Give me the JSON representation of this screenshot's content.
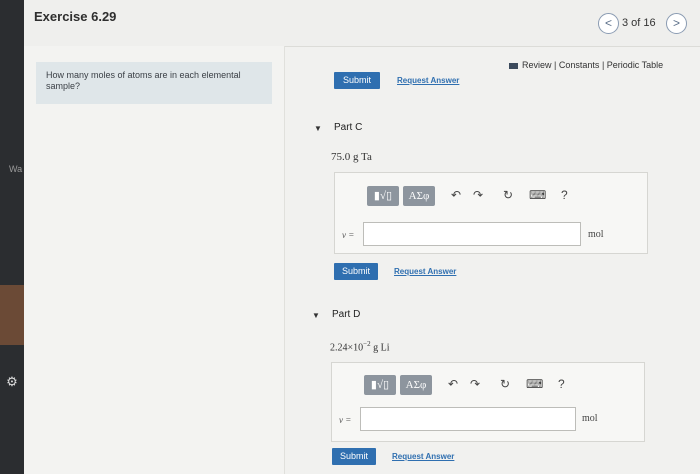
{
  "header": {
    "title": "Exercise 6.29",
    "page_count": "3 of 16",
    "prev_label": "<",
    "next_label": ">"
  },
  "sidebar": {
    "partial_text": "Wa"
  },
  "question": {
    "text": "How many moles of atoms are in each elemental sample?"
  },
  "links": {
    "review": "Review",
    "constants": "Constants",
    "periodic_table": "Periodic Table",
    "separator": "|"
  },
  "buttons": {
    "submit": "Submit",
    "request_answer": "Request Answer"
  },
  "parts": [
    {
      "label": "Part C",
      "sample": "75.0 g Ta",
      "variable": "ν =",
      "unit": "mol",
      "value": ""
    },
    {
      "label": "Part D",
      "sample_mantissa": "2.24×10",
      "sample_exponent": "−2",
      "sample_rest": " g Li",
      "variable": "ν =",
      "unit": "mol",
      "value": ""
    }
  ],
  "toolbar": {
    "templates": "▮√▯",
    "symbols": "ΑΣφ",
    "help": "?"
  }
}
